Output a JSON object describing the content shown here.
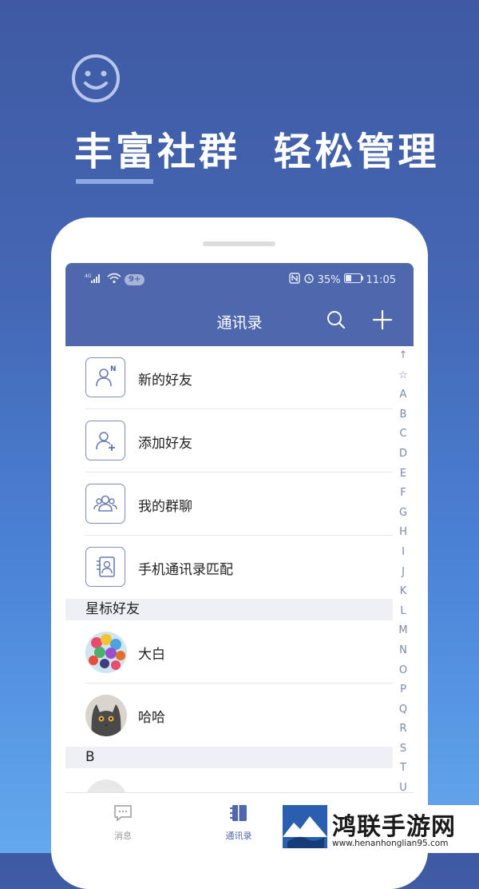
{
  "promo": {
    "icon": "smiley-face-icon",
    "headline": "丰富社群  轻松管理"
  },
  "statusbar": {
    "signal_label": "⁴ᴳ",
    "notification_badge": "9+",
    "battery_percent": "35%",
    "time": "11:05",
    "icons": [
      "signal-icon",
      "wifi-icon",
      "nfc-icon",
      "alarm-icon",
      "battery-icon"
    ]
  },
  "appbar": {
    "title": "通讯录",
    "search_icon": "search-icon",
    "add_icon": "plus-icon"
  },
  "menu": [
    {
      "label": "新的好友",
      "icon": "new-friend-icon"
    },
    {
      "label": "添加好友",
      "icon": "add-friend-icon"
    },
    {
      "label": "我的群聊",
      "icon": "group-chat-icon"
    },
    {
      "label": "手机通讯录匹配",
      "icon": "phone-contacts-icon"
    }
  ],
  "sections": {
    "starred": {
      "header": "星标好友",
      "contacts": [
        {
          "name": "大白",
          "avatar": "balloons-avatar"
        },
        {
          "name": "哈哈",
          "avatar": "cat-avatar"
        }
      ]
    },
    "b": {
      "header": "B"
    }
  },
  "index_letters": [
    "↑",
    "☆",
    "A",
    "B",
    "C",
    "D",
    "E",
    "F",
    "G",
    "H",
    "I",
    "J",
    "K",
    "L",
    "M",
    "N",
    "O",
    "P",
    "Q",
    "R",
    "S",
    "T",
    "U"
  ],
  "tabs": [
    {
      "label": "消息",
      "icon": "message-icon",
      "active": false
    },
    {
      "label": "通讯录",
      "icon": "contacts-book-icon",
      "active": true
    }
  ],
  "watermark": {
    "title": "鸿联手游网",
    "url": "www.henanhonglian95.com"
  },
  "colors": {
    "primary": "#4f67ad",
    "background_top": "#3f5aa3",
    "background_bottom": "#63a9ef"
  }
}
